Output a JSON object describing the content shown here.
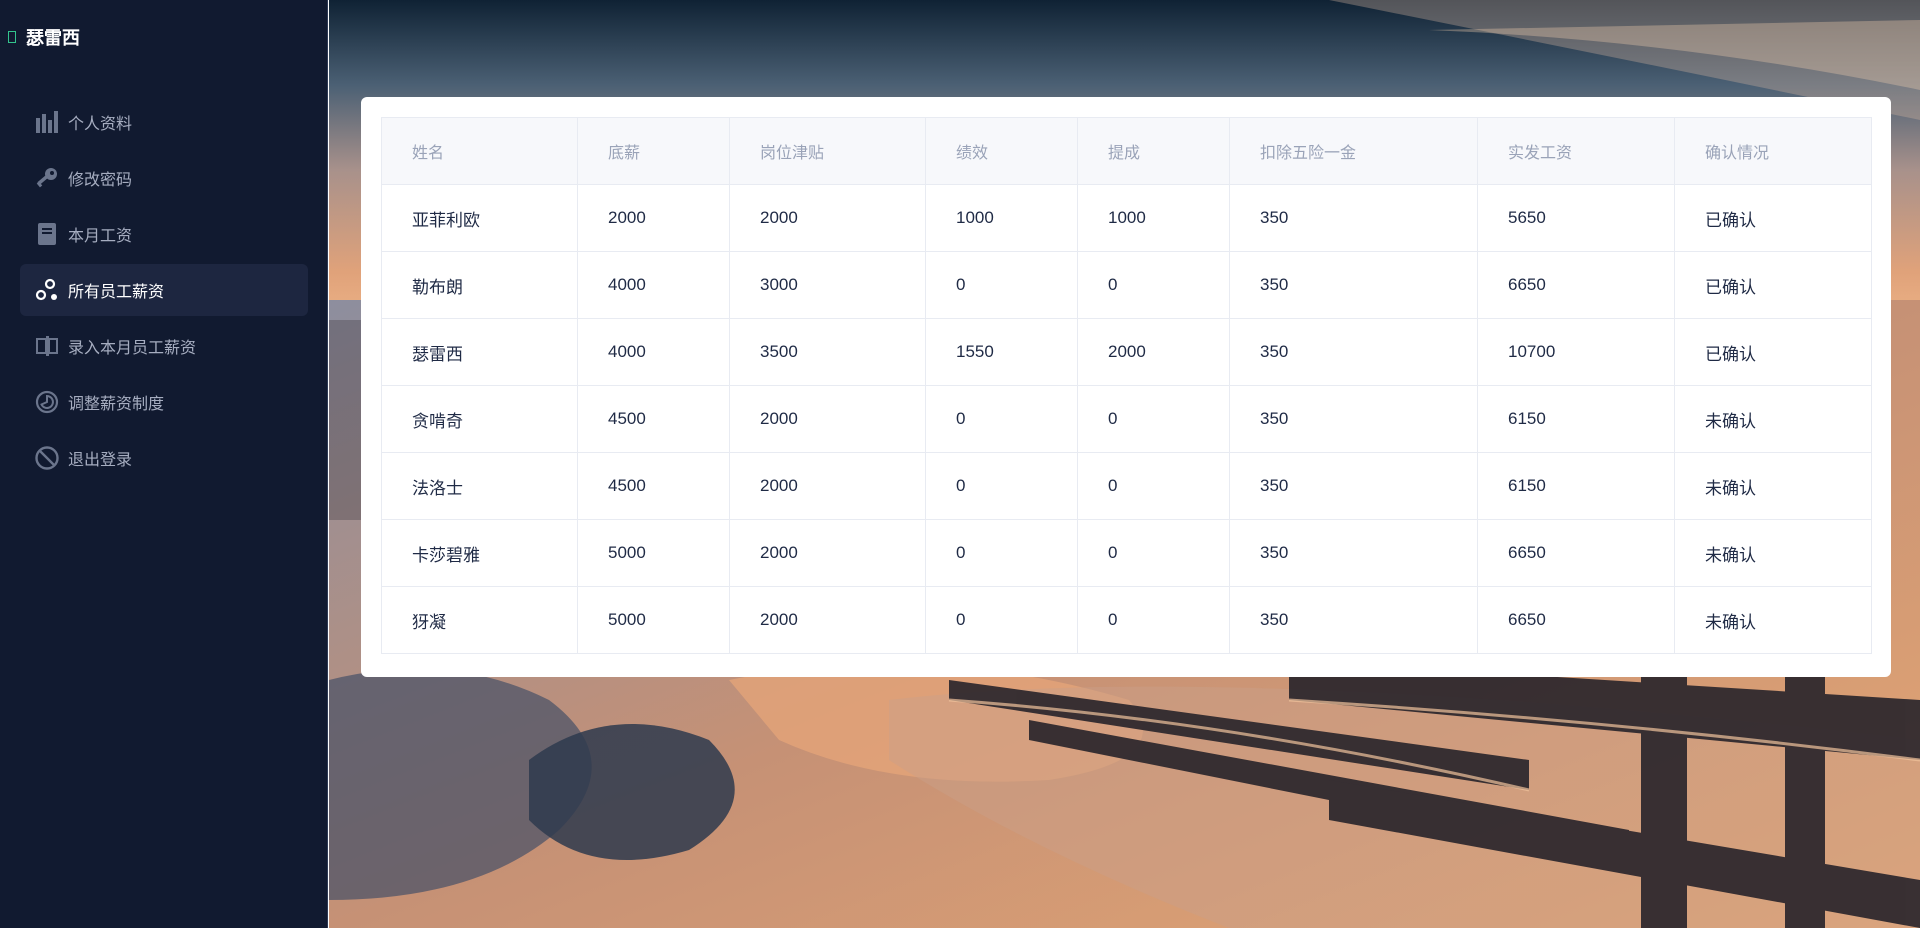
{
  "sidebar": {
    "brand": "瑟雷西",
    "items": [
      {
        "label": "个人资料",
        "icon": "bar-chart-icon"
      },
      {
        "label": "修改密码",
        "icon": "key-icon"
      },
      {
        "label": "本月工资",
        "icon": "book-icon"
      },
      {
        "label": "所有员工薪资",
        "icon": "nodes-icon"
      },
      {
        "label": "录入本月员工薪资",
        "icon": "input-icon"
      },
      {
        "label": "调整薪资制度",
        "icon": "pie-chart-icon"
      },
      {
        "label": "退出登录",
        "icon": "logout-icon"
      }
    ],
    "active_index": 3
  },
  "table": {
    "headers": [
      "姓名",
      "底薪",
      "岗位津贴",
      "绩效",
      "提成",
      "扣除五险一金",
      "实发工资",
      "确认情况"
    ],
    "rows": [
      [
        "亚菲利欧",
        "2000",
        "2000",
        "1000",
        "1000",
        "350",
        "5650",
        "已确认"
      ],
      [
        "勒布朗",
        "4000",
        "3000",
        "0",
        "0",
        "350",
        "6650",
        "已确认"
      ],
      [
        "瑟雷西",
        "4000",
        "3500",
        "1550",
        "2000",
        "350",
        "10700",
        "已确认"
      ],
      [
        "贪啃奇",
        "4500",
        "2000",
        "0",
        "0",
        "350",
        "6150",
        "未确认"
      ],
      [
        "法洛士",
        "4500",
        "2000",
        "0",
        "0",
        "350",
        "6150",
        "未确认"
      ],
      [
        "卡莎碧雅",
        "5000",
        "2000",
        "0",
        "0",
        "350",
        "6650",
        "未确认"
      ],
      [
        "犽凝",
        "5000",
        "2000",
        "0",
        "0",
        "350",
        "6650",
        "未确认"
      ]
    ]
  },
  "colors": {
    "sidebar_bg": "#111a30",
    "active_item_bg": "#1d2640",
    "brand_accent": "#32c48d"
  }
}
